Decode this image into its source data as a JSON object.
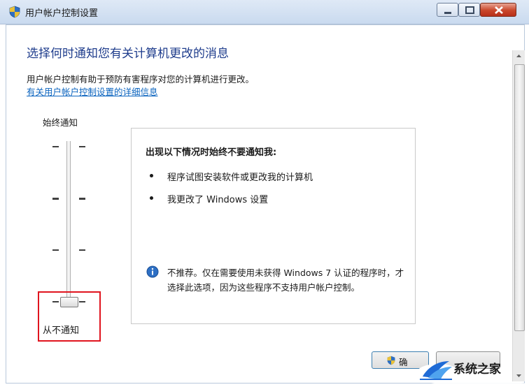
{
  "window": {
    "title": "用户帐户控制设置"
  },
  "main": {
    "heading": "选择何时通知您有关计算机更改的消息",
    "description": "用户帐户控制有助于预防有害程序对您的计算机进行更改。",
    "link": "有关用户帐户控制设置的详细信息"
  },
  "slider": {
    "top_label": "始终通知",
    "bottom_label": "从不通知",
    "levels": 4,
    "selected_level": 1
  },
  "info": {
    "title": "出现以下情况时始终不要通知我:",
    "bullets": [
      "程序试图安装软件或更改我的计算机",
      "我更改了 Windows 设置"
    ],
    "warning": "不推荐。仅在需要使用未获得 Windows 7 认证的程序时，才选择此选项，因为这些程序不支持用户帐户控制。"
  },
  "buttons": {
    "ok_label": "确"
  },
  "watermark": {
    "text": "系统之家"
  },
  "colors": {
    "heading": "#1e3c8c",
    "link": "#0b64bf",
    "highlight": "#e0141e"
  },
  "icons": {
    "title": "uac-shield-icon",
    "info": "info-icon",
    "ok": "uac-shield-icon"
  }
}
